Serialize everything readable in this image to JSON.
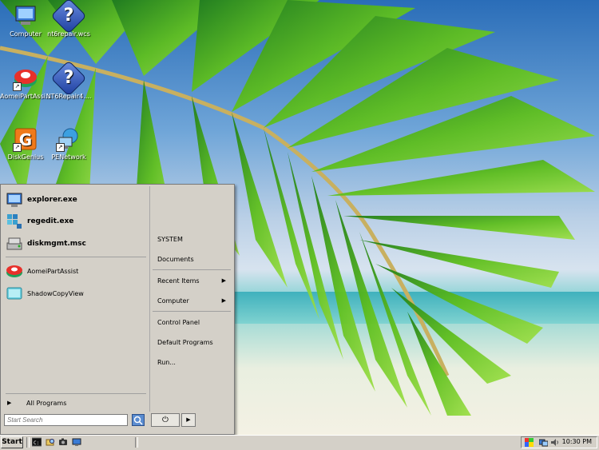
{
  "desktop": {
    "icons": [
      {
        "label": "Computer"
      },
      {
        "label": "nt6repair.wcs"
      },
      {
        "label": "AomeiPartAssi..."
      },
      {
        "label": "NT6Repair4...."
      },
      {
        "label": "DiskGenius"
      },
      {
        "label": "PENetwork"
      }
    ]
  },
  "start_menu": {
    "pinned": [
      {
        "label": "explorer.exe"
      },
      {
        "label": "regedit.exe"
      },
      {
        "label": "diskmgmt.msc"
      }
    ],
    "recent": [
      {
        "label": "AomeiPartAssist"
      },
      {
        "label": "ShadowCopyView"
      }
    ],
    "all_programs": "All Programs",
    "search_placeholder": "Start Search",
    "right": [
      {
        "label": "SYSTEM"
      },
      {
        "label": "Documents"
      },
      {
        "label": "Recent Items"
      },
      {
        "label": "Computer"
      },
      {
        "label": "Control Panel"
      },
      {
        "label": "Default Programs"
      },
      {
        "label": "Run..."
      }
    ]
  },
  "taskbar": {
    "start_label": "Start",
    "clock": "10:30 PM"
  }
}
